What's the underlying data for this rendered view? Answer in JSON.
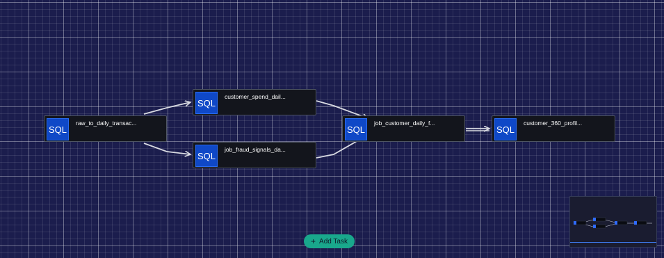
{
  "dag": {
    "nodes": [
      {
        "id": "n1",
        "type_label": "SQL",
        "label": "raw_to_daily_transac..."
      },
      {
        "id": "n2",
        "type_label": "SQL",
        "label": "customer_spend_dail..."
      },
      {
        "id": "n3",
        "type_label": "SQL",
        "label": "job_fraud_signals_da..."
      },
      {
        "id": "n4",
        "type_label": "SQL",
        "label": "job_customer_daily_f..."
      },
      {
        "id": "n5",
        "type_label": "SQL",
        "label": "customer_360_profil..."
      }
    ],
    "edges": [
      {
        "from": "n1",
        "to": "n2"
      },
      {
        "from": "n1",
        "to": "n3"
      },
      {
        "from": "n2",
        "to": "n4"
      },
      {
        "from": "n3",
        "to": "n4"
      },
      {
        "from": "n4",
        "to": "n5"
      }
    ]
  },
  "toolbar": {
    "add_task_label": "Add Task",
    "add_task_icon": "plus-icon"
  },
  "colors": {
    "canvas_bg": "#1b1d4d",
    "node_bg": "#13151c",
    "node_icon_bg": "#0f48c7",
    "edge": "#d9dbe2",
    "add_task_bg": "#19a88c",
    "minimap_accent": "#3f7bf2"
  }
}
